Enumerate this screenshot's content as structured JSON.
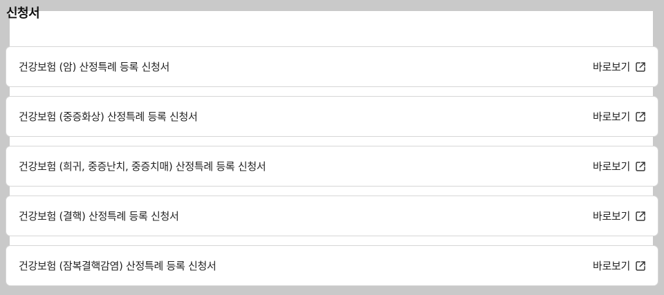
{
  "section": {
    "title": "신청서"
  },
  "rows": [
    {
      "title": "건강보험 (암) 산정특례 등록 신청서",
      "link_label": "바로보기",
      "icon": "external-link-icon"
    },
    {
      "title": "건강보험 (중증화상) 산정특례 등록 신청서",
      "link_label": "바로보기",
      "icon": "external-link-icon"
    },
    {
      "title": "건강보험 (희귀, 중증난치, 중증치매) 산정특례 등록 신청서",
      "link_label": "바로보기",
      "icon": "external-link-icon"
    },
    {
      "title": "건강보험 (결핵) 산정특례 등록 신청서",
      "link_label": "바로보기",
      "icon": "external-link-icon"
    },
    {
      "title": "건강보험 (잠복결핵감염) 산정특례 등록 신청서",
      "link_label": "바로보기",
      "icon": "external-link-icon"
    }
  ]
}
